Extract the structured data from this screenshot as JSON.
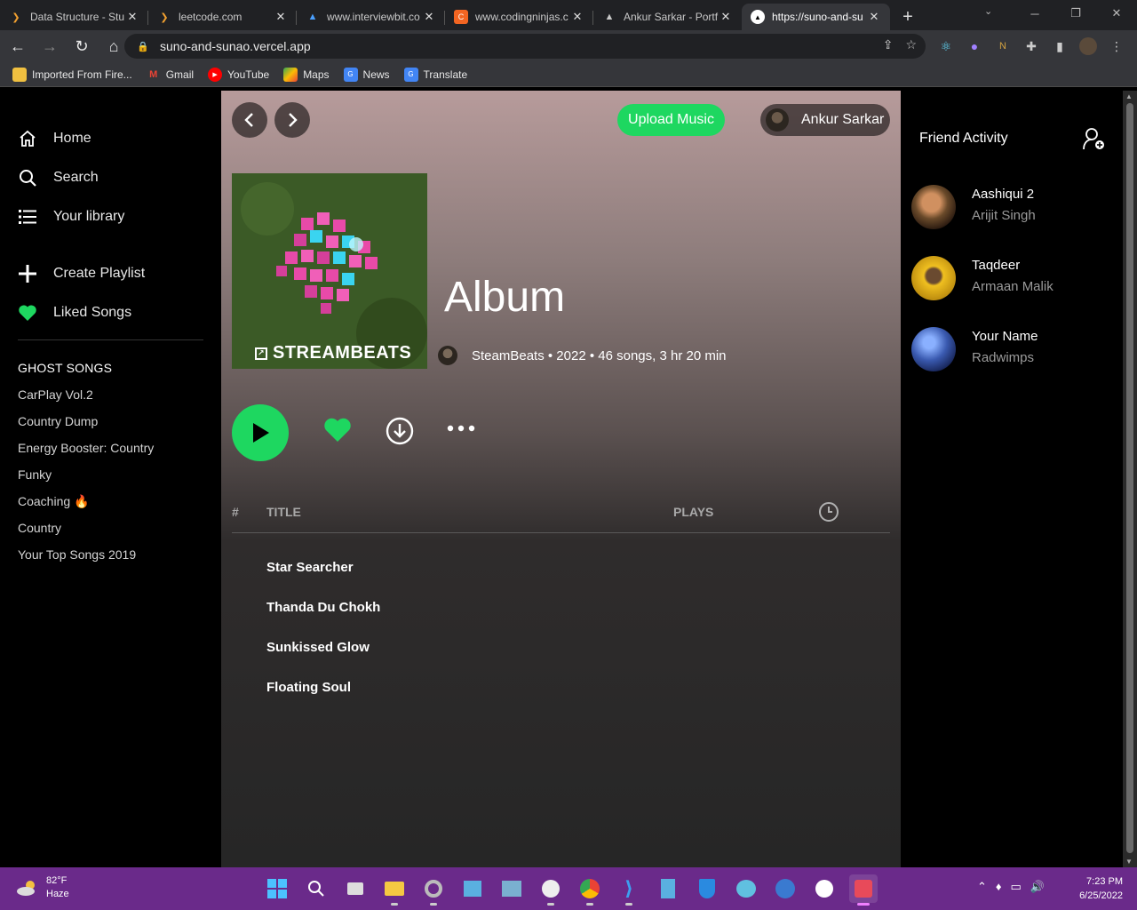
{
  "browser": {
    "tabs": [
      {
        "title": "Data Structure - Stu",
        "icon": "code-icon",
        "color": "#f0a030"
      },
      {
        "title": "leetcode.com",
        "icon": "code-icon",
        "color": "#f0a030"
      },
      {
        "title": "www.interviewbit.co",
        "icon": "interviewbit-icon",
        "color": "#4aa0ff"
      },
      {
        "title": "www.codingninjas.c",
        "icon": "codingninjas-icon",
        "color": "#f26522"
      },
      {
        "title": "Ankur Sarkar - Portf",
        "icon": "triangle-icon",
        "color": "#ffffff"
      },
      {
        "title": "https://suno-and-su",
        "icon": "triangle-icon",
        "color": "#ffffff"
      }
    ],
    "address": "suno-and-sunao.vercel.app",
    "bookmarks": [
      {
        "label": "Imported From Fire...",
        "icon": "folder-icon",
        "color": "#f0c040"
      },
      {
        "label": "Gmail",
        "icon": "gmail-icon",
        "color": "#ea4335"
      },
      {
        "label": "YouTube",
        "icon": "youtube-icon",
        "color": "#ff0000"
      },
      {
        "label": "Maps",
        "icon": "maps-icon",
        "color": "#34a853"
      },
      {
        "label": "News",
        "icon": "news-icon",
        "color": "#4285f4"
      },
      {
        "label": "Translate",
        "icon": "translate-icon",
        "color": "#4285f4"
      }
    ]
  },
  "sidebar": {
    "nav": [
      {
        "label": "Home",
        "icon": "home-icon"
      },
      {
        "label": "Search",
        "icon": "search-icon"
      },
      {
        "label": "Your library",
        "icon": "library-icon"
      }
    ],
    "actions": [
      {
        "label": "Create Playlist",
        "icon": "plus-icon"
      },
      {
        "label": "Liked Songs",
        "icon": "heart-icon"
      }
    ],
    "section_title": "GHOST SONGS",
    "playlists": [
      "CarPlay Vol.2",
      "Country Dump",
      "Energy Booster: Country",
      "Funky",
      "Coaching 🔥",
      "Country",
      "Your Top Songs 2019"
    ]
  },
  "main": {
    "upload_label": "Upload Music",
    "user_name": "Ankur Sarkar",
    "cover_text": "STREAMBEATS",
    "album_title": "Album",
    "meta": "SteamBeats • 2022 • 46 songs, 3 hr 20 min",
    "table": {
      "num_header": "#",
      "title_header": "TITLE",
      "plays_header": "PLAYS"
    },
    "songs": [
      "Star Searcher",
      "Thanda Du Chokh",
      "Sunkissed Glow",
      "Floating Soul"
    ],
    "accent": "#1ed760"
  },
  "friends": {
    "title": "Friend Activity",
    "list": [
      {
        "song": "Aashiqui 2",
        "artist": "Arijit Singh"
      },
      {
        "song": "Taqdeer",
        "artist": "Armaan Malik"
      },
      {
        "song": "Your Name",
        "artist": "Radwimps"
      }
    ]
  },
  "taskbar": {
    "temperature": "82°F",
    "weather": "Haze",
    "time": "7:23 PM",
    "date": "6/25/2022",
    "color": "#6a2a8a"
  }
}
